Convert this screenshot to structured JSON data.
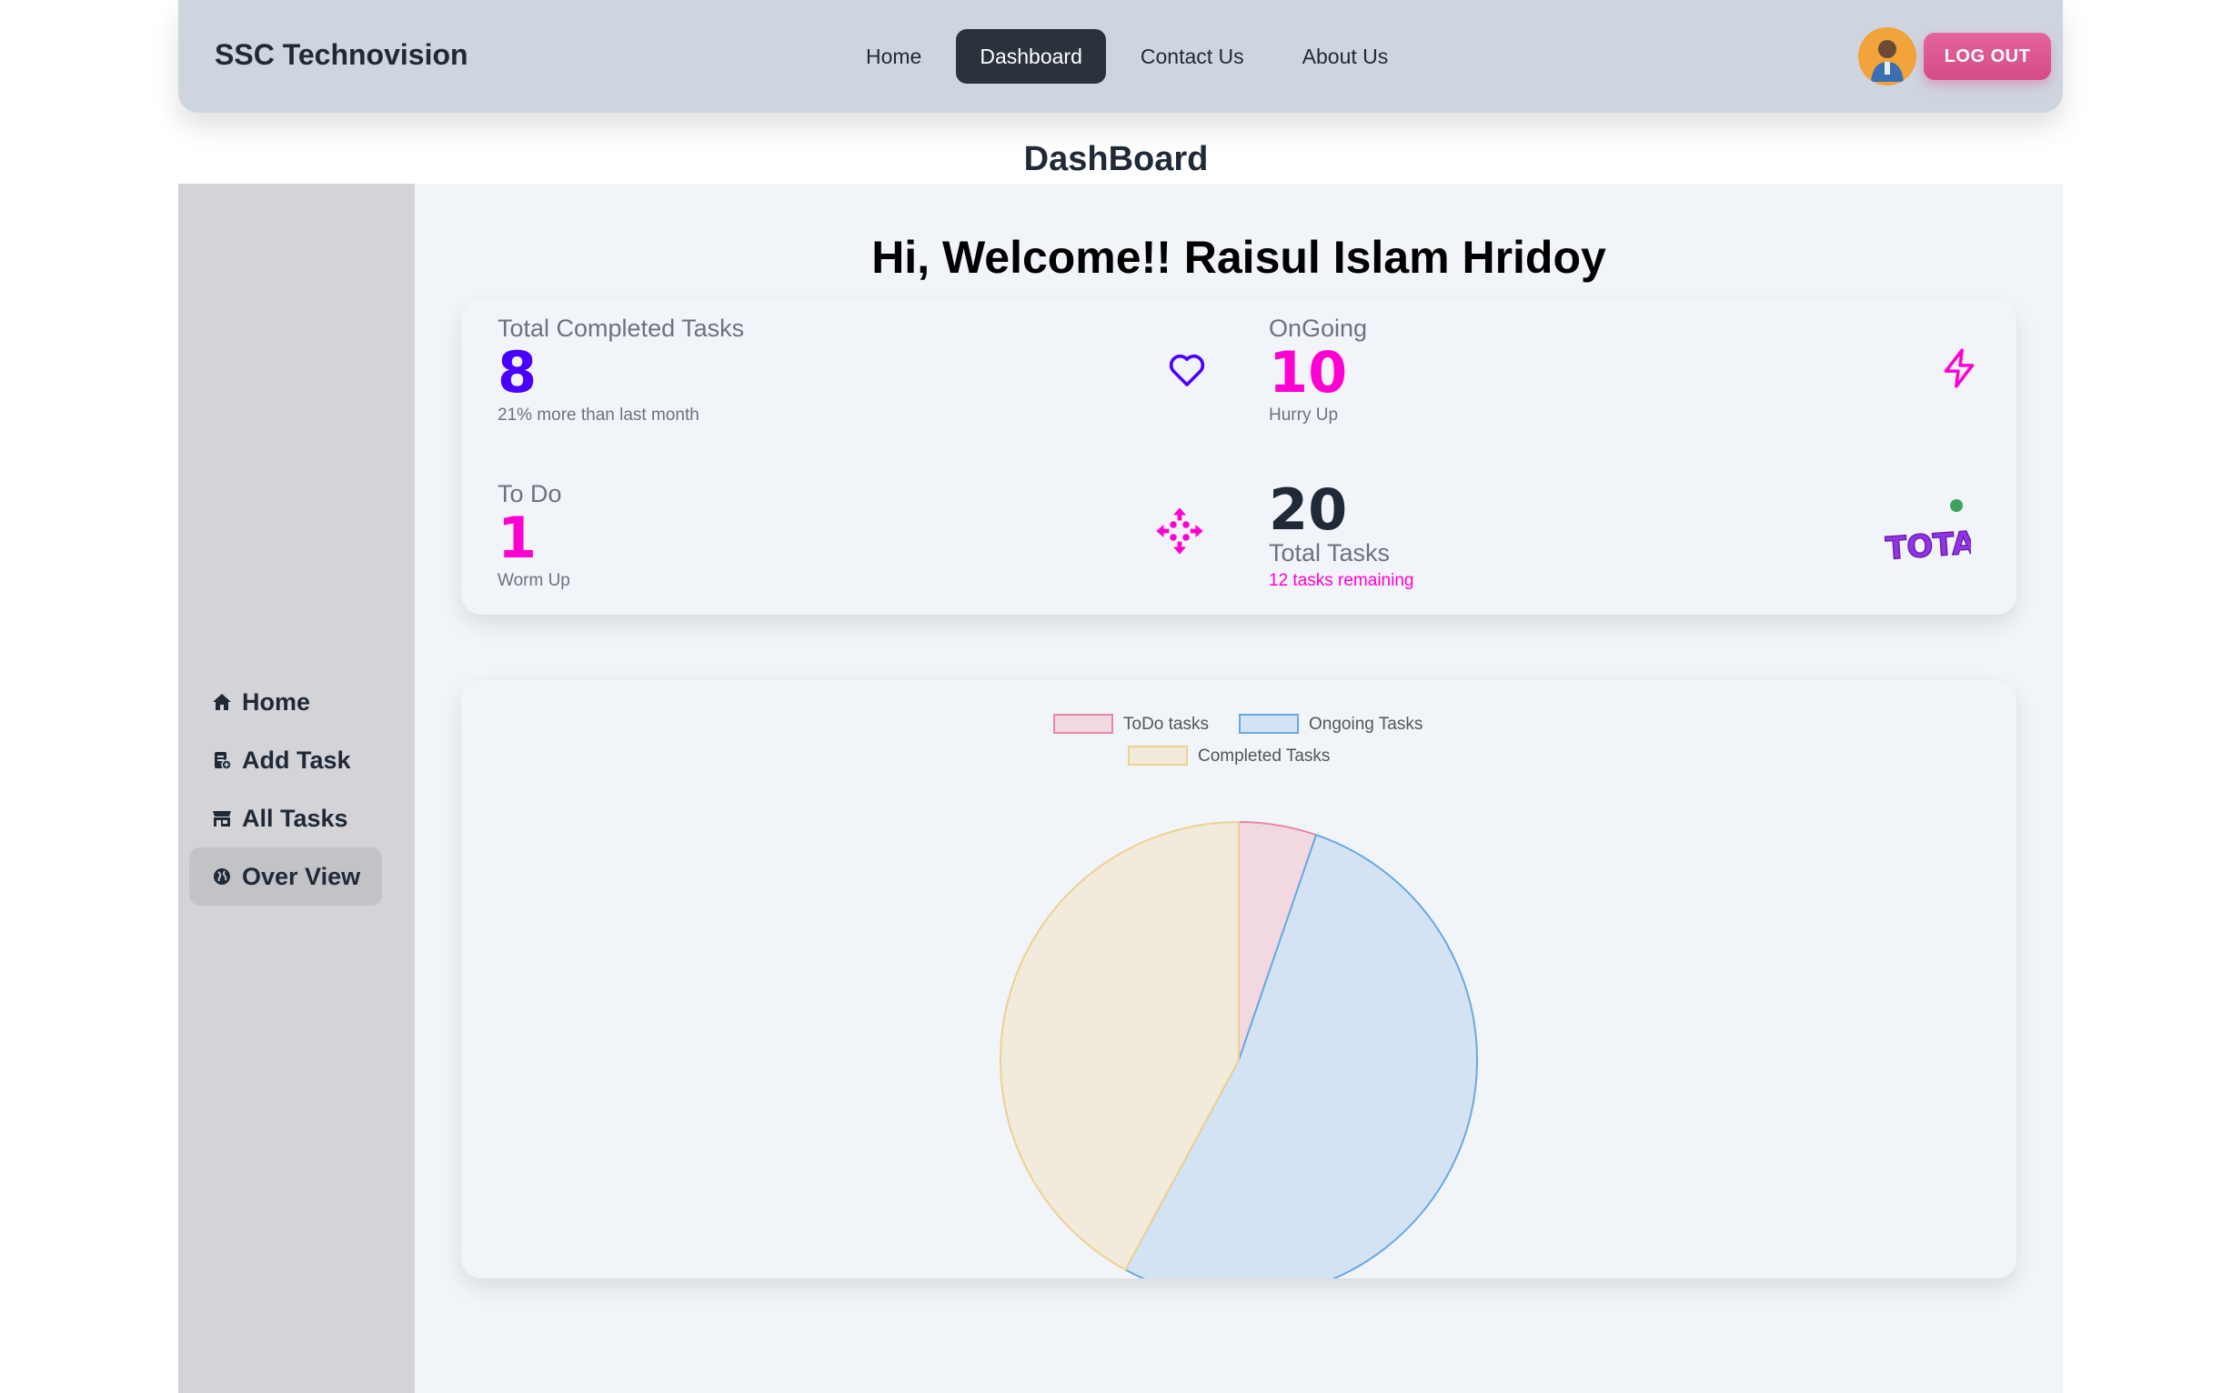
{
  "navbar": {
    "brand": "SSC Technovision",
    "links": [
      "Home",
      "Dashboard",
      "Contact Us",
      "About Us"
    ],
    "active_link": "Dashboard",
    "logout_label": "LOG OUT"
  },
  "page_title": "DashBoard",
  "sidebar": {
    "items": [
      {
        "label": "Home",
        "icon": "home-icon"
      },
      {
        "label": "Add Task",
        "icon": "add-task-icon"
      },
      {
        "label": "All Tasks",
        "icon": "store-icon"
      },
      {
        "label": "Over View",
        "icon": "globe-icon",
        "active": true
      }
    ]
  },
  "main": {
    "welcome": "Hi, Welcome!! Raisul Islam Hridoy",
    "stats": {
      "completed": {
        "title": "Total Completed Tasks",
        "value": "8",
        "desc": "21% more than last month",
        "color": "#4a00ff",
        "icon": "heart-icon"
      },
      "ongoing": {
        "title": "OnGoing",
        "value": "10",
        "desc": "Hurry Up",
        "color": "#ff00d3",
        "icon": "lightning-icon"
      },
      "todo": {
        "title": "To Do",
        "value": "1",
        "desc": "Worm Up",
        "color": "#ff00d3",
        "icon": "move-arrows-icon"
      },
      "total": {
        "value": "20",
        "title": "Total Tasks",
        "desc": "12 tasks remaining",
        "desc_color": "#ff00d3",
        "icon": "total-badge-icon",
        "badge_text": "TOTAL"
      }
    }
  },
  "chart_data": {
    "type": "pie",
    "series": [
      {
        "name": "ToDo tasks",
        "value": 1,
        "fill": "#f1d8e1",
        "stroke": "#e58aa4"
      },
      {
        "name": "Ongoing Tasks",
        "value": 10,
        "fill": "#d4e3f4",
        "stroke": "#6aa8e0"
      },
      {
        "name": "Completed Tasks",
        "value": 8,
        "fill": "#f2ebdb",
        "stroke": "#ecd193"
      }
    ],
    "legend_position": "top"
  }
}
